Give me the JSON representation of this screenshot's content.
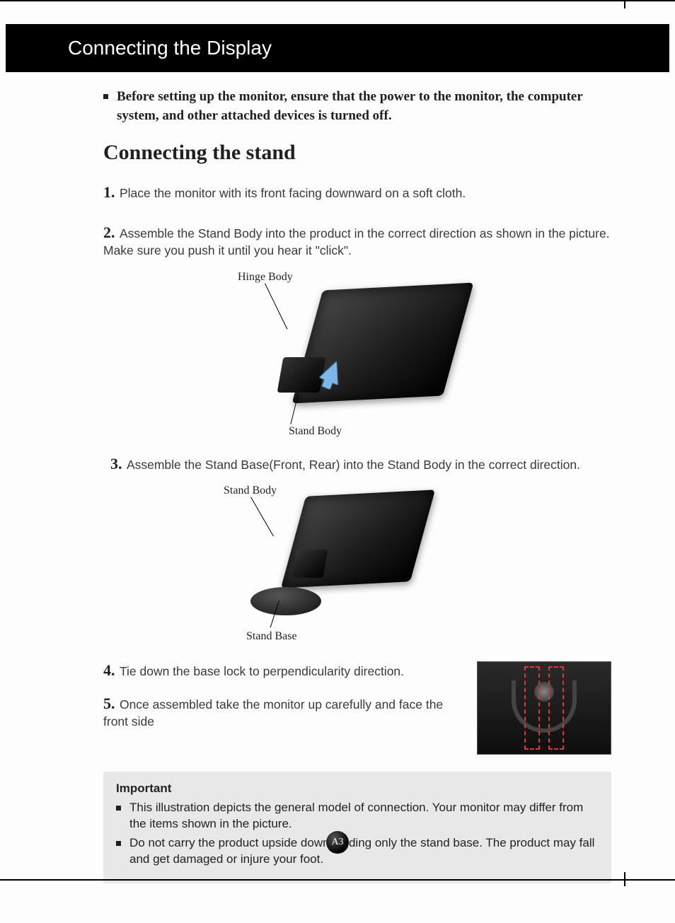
{
  "header": {
    "title": "Connecting the Display"
  },
  "warning": "Before setting up the monitor, ensure that the power to the monitor, the computer system, and other attached devices is turned off.",
  "section_title": "Connecting the stand",
  "steps": {
    "s1": {
      "num": "1.",
      "text": "Place the monitor with its front facing downward on a soft cloth."
    },
    "s2": {
      "num": "2.",
      "text": "Assemble the Stand Body into the product in the correct direction as shown in the picture. Make sure you push it until you hear it \"click\"."
    },
    "s3": {
      "num": "3.",
      "text": "Assemble the Stand Base(Front, Rear) into the Stand Body in the correct direction."
    },
    "s4": {
      "num": "4.",
      "text": "Tie down the base lock to perpendicularity direction."
    },
    "s5": {
      "num": "5.",
      "text": "Once assembled take the monitor up carefully and face the front side"
    }
  },
  "fig1": {
    "label_top": "Hinge Body",
    "label_bottom": "Stand Body"
  },
  "fig2": {
    "label_top": "Stand Body",
    "label_bottom": "Stand Base"
  },
  "important": {
    "title": "Important",
    "items": [
      "This illustration depicts the general model of connection. Your monitor may differ from the items shown in the picture.",
      "Do not carry the product upside down holding only the stand base. The product may fall and get damaged or injure your foot."
    ]
  },
  "page_number": "A3"
}
